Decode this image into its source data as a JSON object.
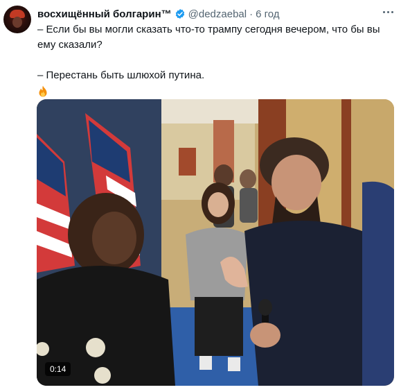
{
  "tweet": {
    "display_name": "восхищённый болгарин™",
    "handle": "@dedzaebal",
    "separator": "·",
    "time": "6 год",
    "text_line1": "– Если бы вы могли сказать что-то трампу сегодня вечером, что бы вы ему сказали?",
    "text_line2": "– Перестань быть шлюхой путина.",
    "emoji": "fire-icon",
    "video_duration": "0:14"
  },
  "colors": {
    "text": "#0f1419",
    "secondary": "#536471",
    "verified": "#1d9bf0"
  }
}
